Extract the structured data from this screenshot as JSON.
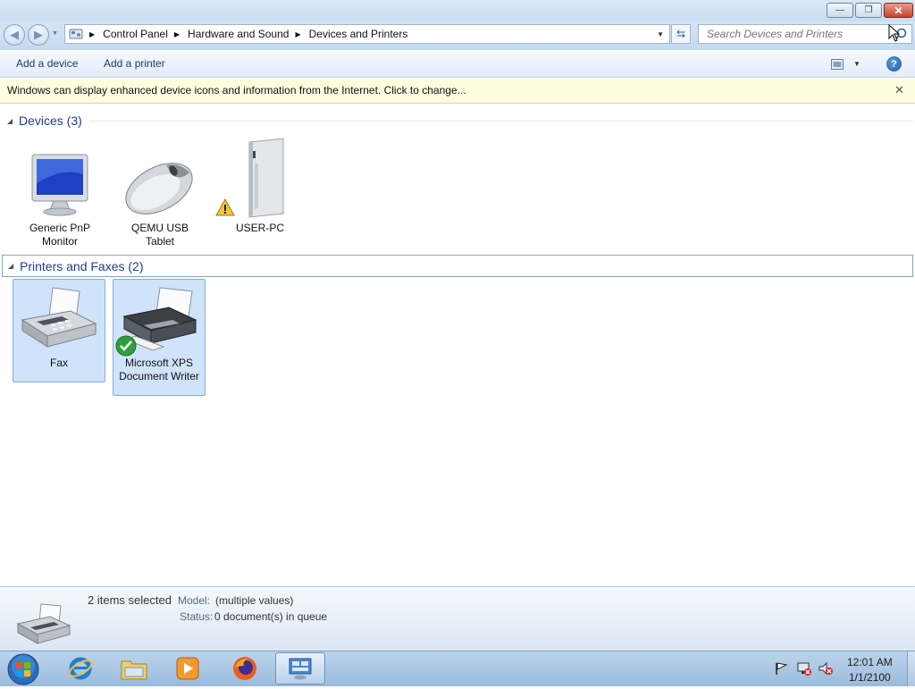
{
  "window": {
    "minimize_glyph": "—",
    "restore_glyph": "❐",
    "close_glyph": "✕"
  },
  "nav": {
    "back_glyph": "◀",
    "forward_glyph": "▶",
    "breadcrumbs": [
      "Control Panel",
      "Hardware and Sound",
      "Devices and Printers"
    ],
    "search_placeholder": "Search Devices and Printers"
  },
  "commands": {
    "add_device": "Add a device",
    "add_printer": "Add a printer"
  },
  "infobar": {
    "message": "Windows can display enhanced device icons and information from the Internet. Click to change...",
    "close_glyph": "✕"
  },
  "groups": {
    "devices": {
      "title": "Devices (3)",
      "items": [
        {
          "label_line1": "Generic PnP",
          "label_line2": "Monitor",
          "icon": "monitor-icon"
        },
        {
          "label_line1": "QEMU USB",
          "label_line2": "Tablet",
          "icon": "mouse-icon"
        },
        {
          "label_line1": "USER-PC",
          "label_line2": "",
          "icon": "computer-tower-icon",
          "badge": "warning"
        }
      ]
    },
    "printers": {
      "title": "Printers and Faxes (2)",
      "items": [
        {
          "label_line1": "Fax",
          "label_line2": "",
          "icon": "fax-icon",
          "selected": true
        },
        {
          "label_line1": "Microsoft XPS",
          "label_line2": "Document Writer",
          "icon": "printer-icon",
          "selected": true,
          "badge": "default-check"
        }
      ]
    }
  },
  "details": {
    "selection": "2 items selected",
    "model_label": "Model:",
    "model_value": "(multiple values)",
    "status_label": "Status:",
    "status_value": "0 document(s) in queue"
  },
  "taskbar": {
    "apps": [
      "internet-explorer-icon",
      "windows-explorer-icon",
      "media-player-icon",
      "firefox-icon",
      "devices-and-printers-icon"
    ],
    "clock_time": "12:01 AM",
    "clock_date": "1/1/2100"
  },
  "colors": {
    "accent": "#1e3d8f",
    "selection_bg": "#cfe3fa",
    "infobar_bg": "#fffce0"
  }
}
